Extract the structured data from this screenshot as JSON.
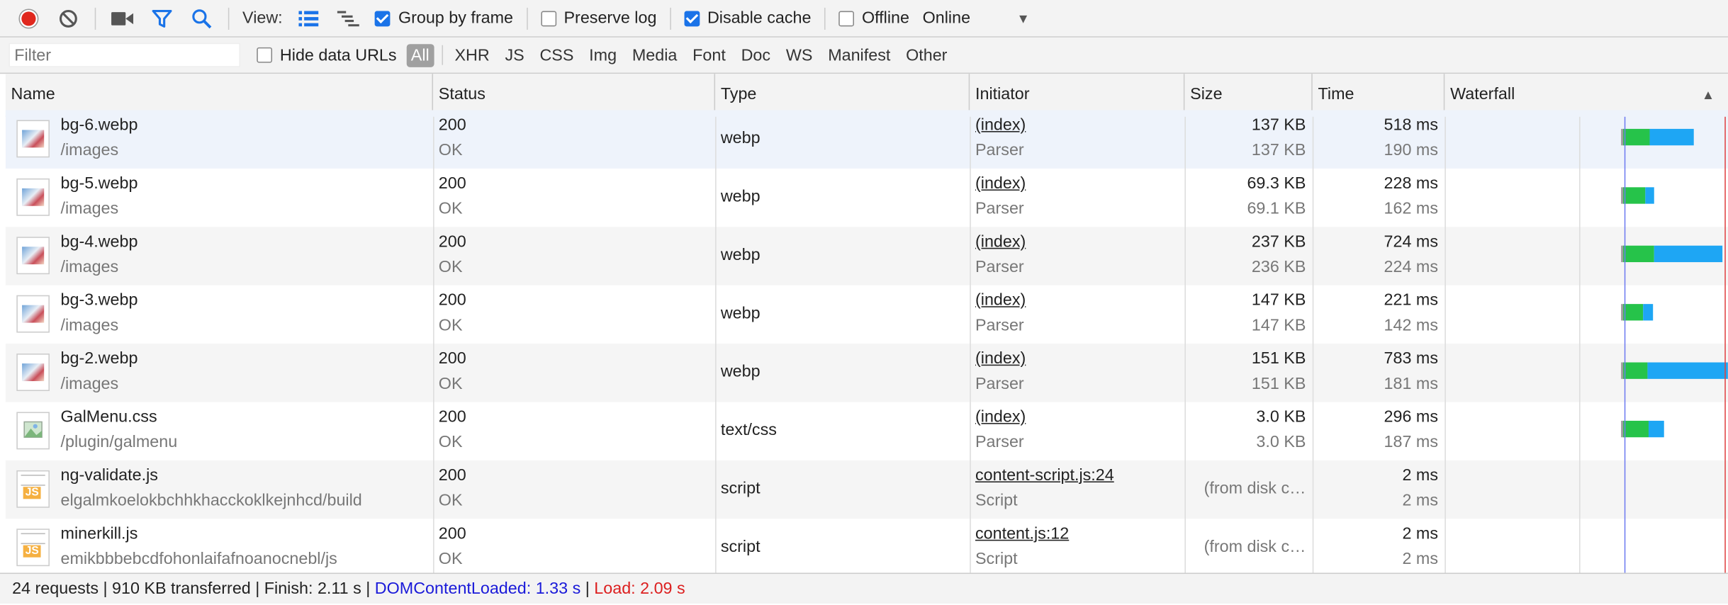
{
  "toolbar": {
    "view_label": "View:",
    "group_by_frame": "Group by frame",
    "preserve_log": "Preserve log",
    "disable_cache": "Disable cache",
    "offline": "Offline",
    "throttle_value": "Online",
    "record_color": "#e0281e",
    "active_icon_color": "#1a73e8"
  },
  "filterbar": {
    "placeholder": "Filter",
    "hide_data_urls": "Hide data URLs",
    "types": [
      "All",
      "XHR",
      "JS",
      "CSS",
      "Img",
      "Media",
      "Font",
      "Doc",
      "WS",
      "Manifest",
      "Other"
    ]
  },
  "columns": {
    "name": "Name",
    "status": "Status",
    "type": "Type",
    "initiator": "Initiator",
    "size": "Size",
    "time": "Time",
    "waterfall": "Waterfall"
  },
  "rows": [
    {
      "name": "bg-6.webp",
      "path": "/images",
      "status": "200",
      "status_text": "OK",
      "type": "webp",
      "initiator": "(index)",
      "initiator_sub": "Parser",
      "size": "137 KB",
      "size_sub": "137 KB",
      "time": "518 ms",
      "time_sub": "190 ms",
      "thumb": "image",
      "wf_green": 190,
      "wf_total": 518
    },
    {
      "name": "bg-5.webp",
      "path": "/images",
      "status": "200",
      "status_text": "OK",
      "type": "webp",
      "initiator": "(index)",
      "initiator_sub": "Parser",
      "size": "69.3 KB",
      "size_sub": "69.1 KB",
      "time": "228 ms",
      "time_sub": "162 ms",
      "thumb": "image",
      "wf_green": 162,
      "wf_total": 228
    },
    {
      "name": "bg-4.webp",
      "path": "/images",
      "status": "200",
      "status_text": "OK",
      "type": "webp",
      "initiator": "(index)",
      "initiator_sub": "Parser",
      "size": "237 KB",
      "size_sub": "236 KB",
      "time": "724 ms",
      "time_sub": "224 ms",
      "thumb": "image",
      "wf_green": 224,
      "wf_total": 724
    },
    {
      "name": "bg-3.webp",
      "path": "/images",
      "status": "200",
      "status_text": "OK",
      "type": "webp",
      "initiator": "(index)",
      "initiator_sub": "Parser",
      "size": "147 KB",
      "size_sub": "147 KB",
      "time": "221 ms",
      "time_sub": "142 ms",
      "thumb": "image",
      "wf_green": 142,
      "wf_total": 221
    },
    {
      "name": "bg-2.webp",
      "path": "/images",
      "status": "200",
      "status_text": "OK",
      "type": "webp",
      "initiator": "(index)",
      "initiator_sub": "Parser",
      "size": "151 KB",
      "size_sub": "151 KB",
      "time": "783 ms",
      "time_sub": "181 ms",
      "thumb": "image",
      "wf_green": 181,
      "wf_total": 783
    },
    {
      "name": "GalMenu.css",
      "path": "/plugin/galmenu",
      "status": "200",
      "status_text": "OK",
      "type": "text/css",
      "initiator": "(index)",
      "initiator_sub": "Parser",
      "size": "3.0 KB",
      "size_sub": "3.0 KB",
      "time": "296 ms",
      "time_sub": "187 ms",
      "thumb": "broken",
      "wf_green": 187,
      "wf_total": 296
    },
    {
      "name": "ng-validate.js",
      "path": "elgalmkoelokbchhkhacckoklkejnhcd/build",
      "status": "200",
      "status_text": "OK",
      "type": "script",
      "initiator": "content-script.js:24",
      "initiator_sub": "Script",
      "size": "(from disk c…",
      "size_sub": "",
      "time": "2 ms",
      "time_sub": "2 ms",
      "thumb": "js",
      "wf_green": 0,
      "wf_total": 0
    },
    {
      "name": "minerkill.js",
      "path": "emikbbbebcdfohonlaifafnoanocnebl/js",
      "status": "200",
      "status_text": "OK",
      "type": "script",
      "initiator": "content.js:12",
      "initiator_sub": "Script",
      "size": "(from disk c…",
      "size_sub": "",
      "time": "2 ms",
      "time_sub": "2 ms",
      "thumb": "js",
      "wf_green": 0,
      "wf_total": 0
    }
  ],
  "status": {
    "requests": "24 requests",
    "transferred": "910 KB transferred",
    "finish": "Finish: 2.11 s",
    "dcl_label": "DOMContentLoaded:",
    "dcl_value": "1.33 s",
    "load": "Load: 2.09 s"
  }
}
